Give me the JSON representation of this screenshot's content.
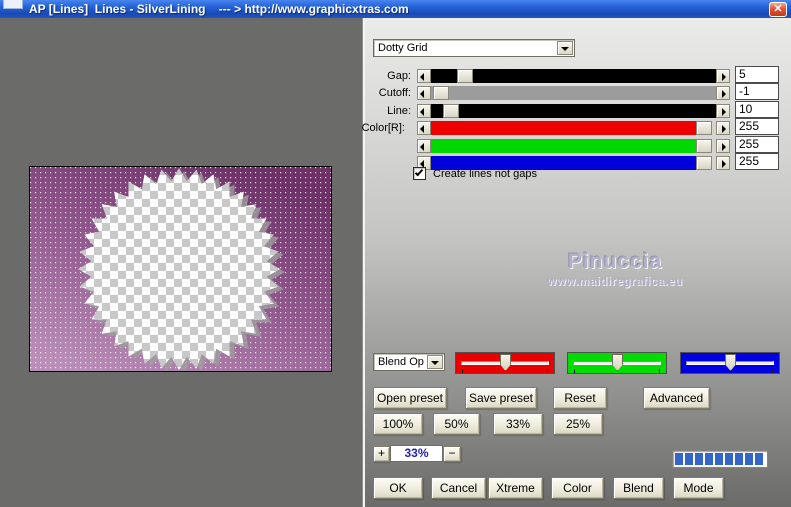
{
  "window": {
    "title": "AP [Lines]  Lines - SilverLining    --- > http://www.graphicxtras.com",
    "close_glyph": "✕"
  },
  "preset_dropdown": {
    "value": "Dotty Grid"
  },
  "sliders": [
    {
      "label": "Gap:",
      "value": "5",
      "track_color": "#000000",
      "thumb_percent": 9
    },
    {
      "label": "Cutoff:",
      "value": "-1",
      "track_color": "#9c9c9c",
      "thumb_percent": 1
    },
    {
      "label": "Line:",
      "value": "10",
      "track_color": "#000000",
      "thumb_percent": 4
    },
    {
      "label": "Color[R]:",
      "value": "255",
      "track_color": "#ee0000",
      "thumb_percent": 93
    },
    {
      "label": "",
      "value": "255",
      "track_color": "#00d800",
      "thumb_percent": 93
    },
    {
      "label": "",
      "value": "255",
      "track_color": "#0000dd",
      "thumb_percent": 93
    }
  ],
  "options": {
    "checkbox_label": "Create lines not gaps",
    "checked": true
  },
  "watermark": {
    "name": "Pinuccia",
    "url": "www.maidiregrafica.eu"
  },
  "blend": {
    "dropdown_value": "Blend Opti",
    "red": "#e80000",
    "green": "#00dc00",
    "blue": "#0000e0"
  },
  "preset_buttons": {
    "open": "Open preset",
    "save": "Save preset",
    "reset": "Reset",
    "advanced": "Advanced"
  },
  "zoom_buttons": {
    "b100": "100%",
    "b50": "50%",
    "b33": "33%",
    "b25": "25%"
  },
  "zoom_stepper": {
    "plus": "+",
    "value": "33%",
    "minus": "−"
  },
  "action_buttons": {
    "ok": "OK",
    "cancel": "Cancel",
    "xtreme": "Xtreme",
    "color": "Color",
    "blend": "Blend",
    "mode": "Mode"
  },
  "progress": {
    "segments": 9,
    "color": "#3465c8"
  },
  "colors": {
    "titlebar_blue": "#2565dc",
    "preview_purple": "#8a4f87",
    "button_face": "#efecdc"
  }
}
